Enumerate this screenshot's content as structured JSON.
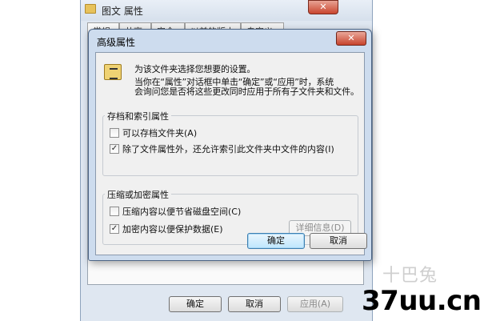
{
  "background_window": {
    "title": "图文 属性",
    "close_label": "✕",
    "tabs": [
      "常规",
      "共享",
      "安全",
      "以前的版本",
      "自定义"
    ],
    "buttons": {
      "ok": "确定",
      "cancel": "取消",
      "apply": "应用(A)"
    }
  },
  "dialog": {
    "title": "高级属性",
    "close_label": "✕",
    "info_lines": [
      "为该文件夹选择您想要的设置。",
      "当你在“属性”对话框中单击“确定”或“应用”时，系统",
      "会询问您是否将这些更改同时应用于所有子文件夹和文件。"
    ],
    "archive_group": {
      "title": "存档和索引属性",
      "options": [
        {
          "label": "可以存档文件夹(A)",
          "checked": false
        },
        {
          "label": "除了文件属性外，还允许索引此文件夹中文件的内容(I)",
          "checked": true
        }
      ]
    },
    "compress_group": {
      "title": "压缩或加密属性",
      "options": [
        {
          "label": "压缩内容以便节省磁盘空间(C)",
          "checked": false
        },
        {
          "label": "加密内容以便保护数据(E)",
          "checked": true
        }
      ],
      "details_label": "详细信息(D)"
    },
    "buttons": {
      "ok": "确定",
      "cancel": "取消"
    }
  },
  "watermark": {
    "logo": "十巴兔",
    "text": "37uu.cn"
  }
}
